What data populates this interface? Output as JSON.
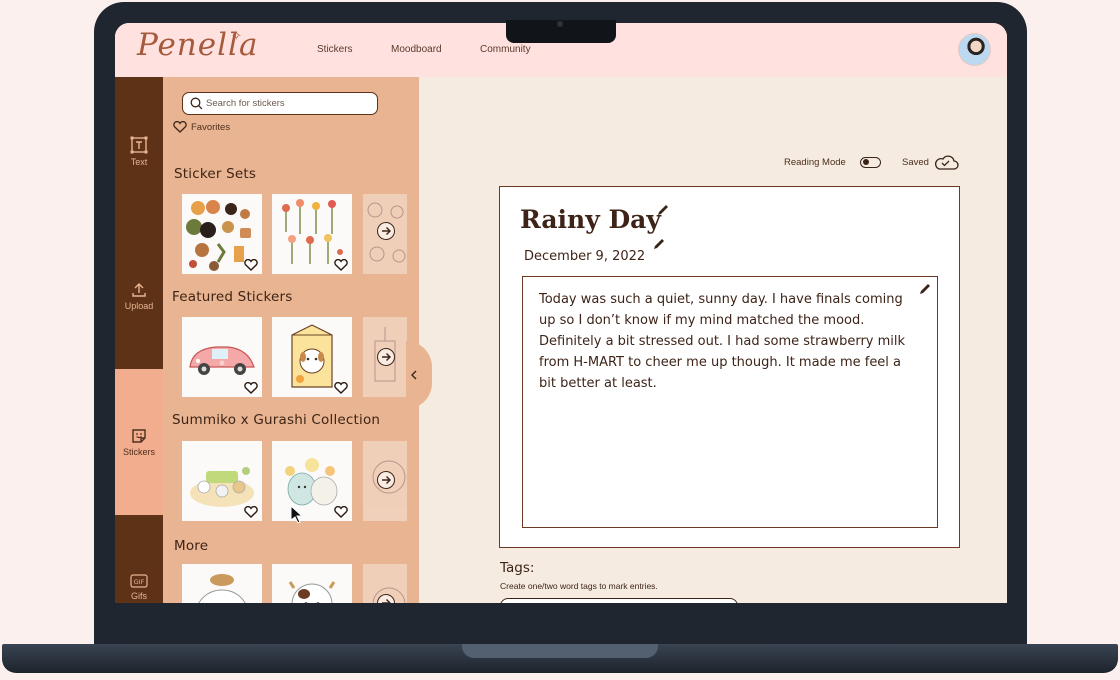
{
  "app": {
    "logo_text": "Penella",
    "logo_star": "✧"
  },
  "nav": {
    "items": [
      "Stickers",
      "Moodboard",
      "Community"
    ]
  },
  "rail": {
    "text_label": "Text",
    "upload_label": "Upload",
    "stickers_label": "Stickers",
    "gifs_label": "Gifs"
  },
  "panel": {
    "search_placeholder": "Search for stickers",
    "favorites_label": "Favorites",
    "sections": [
      {
        "title": "Sticker Sets"
      },
      {
        "title": "Featured Stickers"
      },
      {
        "title": "Summiko x Gurashi Collection"
      },
      {
        "title": "More"
      }
    ]
  },
  "editor": {
    "reading_mode_label": "Reading Mode",
    "saved_label": "Saved",
    "entry_title": "Rainy Day",
    "entry_date": "December 9, 2022",
    "entry_body": "Today was such a quiet, sunny day. I have finals coming up so I don’t know if my mind matched the mood. Definitely a bit stressed out. I had some strawberry milk from H-MART to cheer me up though. It made me feel a bit better at least.",
    "tags_title": "Tags:",
    "tags_hint": "Create one/two word tags to mark entries."
  },
  "colors": {
    "brand_brown": "#5e3217",
    "panel_peach": "#e8b492",
    "topbar_pink": "#ffe2e0",
    "canvas_cream": "#f5ebe1"
  }
}
